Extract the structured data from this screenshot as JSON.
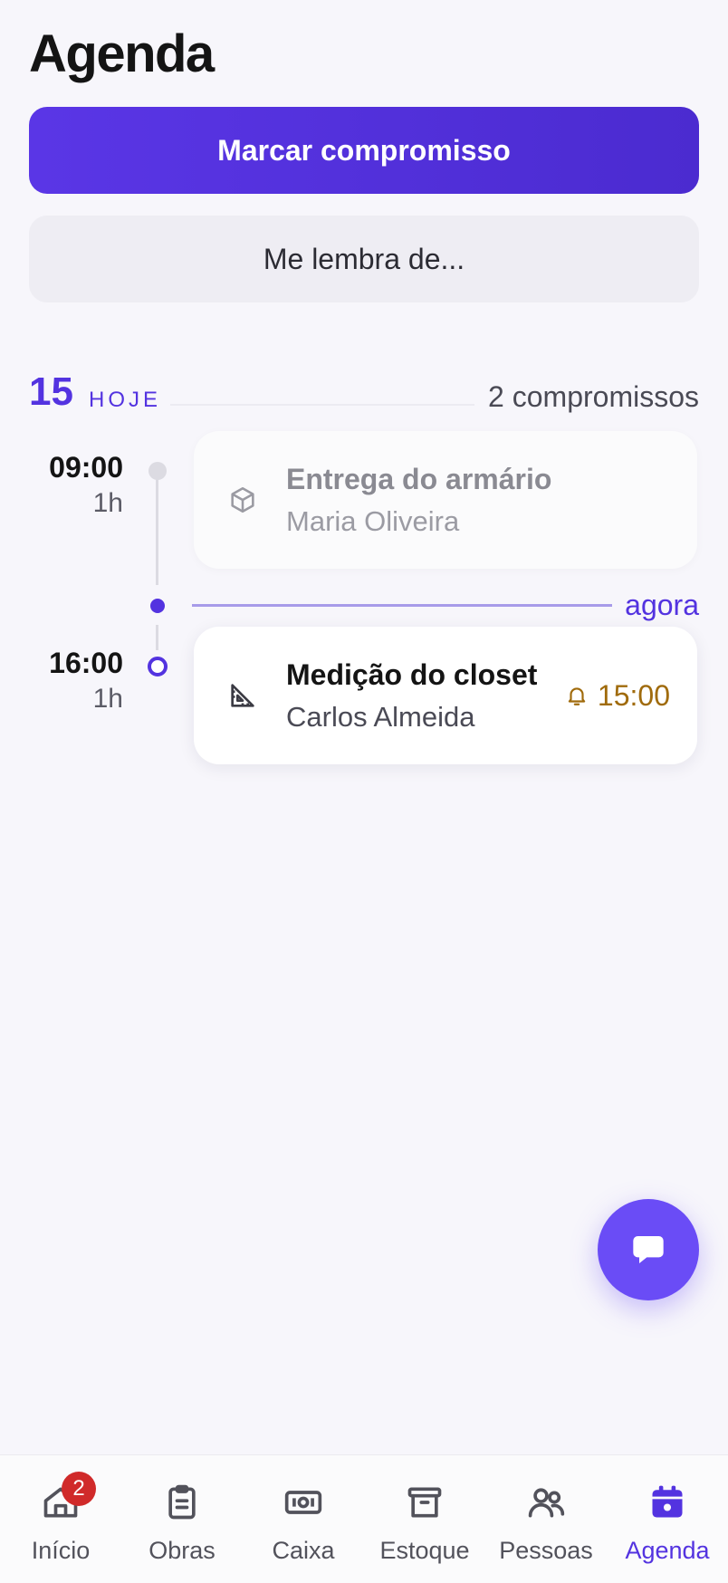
{
  "page": {
    "title": "Agenda"
  },
  "actions": {
    "primary_label": "Marcar compromisso",
    "secondary_label": "Me lembra de..."
  },
  "day": {
    "number": "15",
    "label": "HOJE",
    "count": "2 compromissos"
  },
  "now_label": "agora",
  "appointments": [
    {
      "time": "09:00",
      "duration": "1h",
      "title": "Entrega do armário",
      "client": "Maria Oliveira",
      "icon": "box-icon",
      "status": "past"
    },
    {
      "time": "16:00",
      "duration": "1h",
      "title": "Medição do closet",
      "client": "Carlos Almeida",
      "icon": "ruler-triangle-icon",
      "status": "upcoming",
      "reminder": "15:00"
    }
  ],
  "fab": {
    "icon": "chat-icon"
  },
  "tabs": [
    {
      "label": "Início",
      "icon": "home-icon",
      "badge": "2"
    },
    {
      "label": "Obras",
      "icon": "clipboard-icon"
    },
    {
      "label": "Caixa",
      "icon": "cash-icon"
    },
    {
      "label": "Estoque",
      "icon": "archive-icon"
    },
    {
      "label": "Pessoas",
      "icon": "people-icon"
    },
    {
      "label": "Agenda",
      "icon": "calendar-icon",
      "active": true
    }
  ],
  "colors": {
    "accent": "#5333e0",
    "fab": "#6a4cf6",
    "reminder": "#a06b0c",
    "badge": "#d02a2a"
  }
}
